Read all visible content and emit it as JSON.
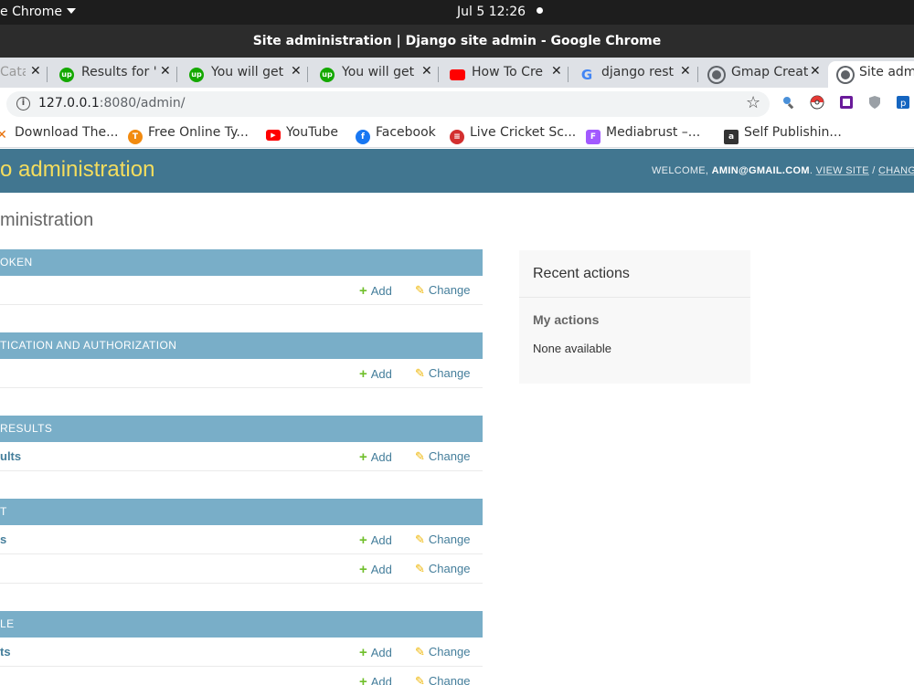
{
  "topbar": {
    "app_name": "e Chrome",
    "clock": "Jul 5  12:26"
  },
  "window": {
    "title": "Site administration | Django site admin - Google Chrome"
  },
  "tabs": [
    {
      "title": "Cata",
      "favicon": "catalog-icon",
      "color": "#e8710a"
    },
    {
      "title": "Results for '",
      "favicon": "upwork-icon",
      "color": "#14a800"
    },
    {
      "title": "You will get",
      "favicon": "upwork-icon",
      "color": "#14a800"
    },
    {
      "title": "You will get",
      "favicon": "upwork-icon",
      "color": "#14a800"
    },
    {
      "title": "How To Cre",
      "favicon": "youtube-icon",
      "color": "#ff0000"
    },
    {
      "title": "django rest",
      "favicon": "google-icon",
      "color": "#4285f4"
    },
    {
      "title": "Gmap Creat",
      "favicon": "chrome-icon",
      "color": "#5f6368"
    },
    {
      "title": "Site admi",
      "favicon": "chrome-icon",
      "color": "#5f6368"
    }
  ],
  "address": {
    "host": "127.0.0.1",
    "rest": ":8080/admin/"
  },
  "bookmarks": [
    {
      "label": "Download The...",
      "icon": "x-icon",
      "color": "#e8710a"
    },
    {
      "label": "Free Online Ty...",
      "icon": "typing-icon",
      "color": "#f28b10"
    },
    {
      "label": "YouTube",
      "icon": "youtube-icon",
      "color": "#ff0000"
    },
    {
      "label": "Facebook",
      "icon": "facebook-icon",
      "color": "#1877f2"
    },
    {
      "label": "Live Cricket Sc...",
      "icon": "cricket-icon",
      "color": "#d32f2f"
    },
    {
      "label": "Mediabrust –...",
      "icon": "figma-icon",
      "color": "#a259ff"
    },
    {
      "label": "Self Publishin...",
      "icon": "book-icon",
      "color": "#333333"
    }
  ],
  "django": {
    "brand": "o administration",
    "welcome": "WELCOME, ",
    "user": "AMIN@GMAIL.COM",
    "view_site": "VIEW SITE",
    "sep": " / ",
    "change_password": "CHANGE P",
    "page_title": "ministration"
  },
  "modules": [
    {
      "caption": "OKEN",
      "rows": [
        {
          "name": ""
        }
      ]
    },
    {
      "caption": "TICATION AND AUTHORIZATION",
      "rows": [
        {
          "name": ""
        }
      ]
    },
    {
      "caption": "RESULTS",
      "rows": [
        {
          "name": "ults"
        }
      ]
    },
    {
      "caption": "T",
      "rows": [
        {
          "name": "s"
        },
        {
          "name": ""
        }
      ]
    },
    {
      "caption": "LE",
      "rows": [
        {
          "name": "ts"
        },
        {
          "name": ""
        }
      ]
    }
  ],
  "labels": {
    "add": "Add",
    "change": "Change"
  },
  "recent": {
    "heading": "Recent actions",
    "my_actions": "My actions",
    "none": "None available"
  },
  "colors": {
    "header_bg": "#417690",
    "brand_yellow": "#f5dd5d",
    "caption_bg": "#79aec8",
    "link": "#447e9b",
    "add_green": "#70bf2b",
    "change_yellow": "#efb80b"
  }
}
